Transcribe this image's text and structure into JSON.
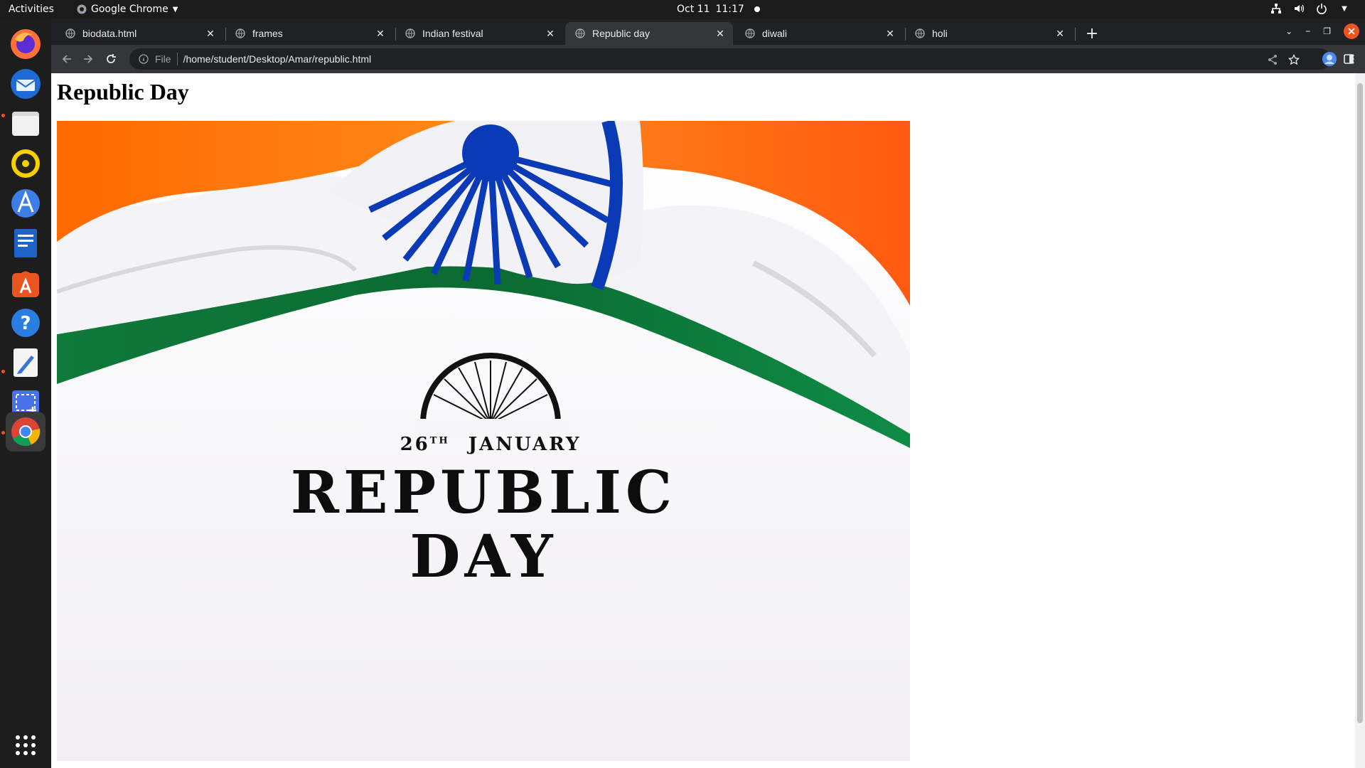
{
  "system": {
    "activities": "Activities",
    "app_name": "Google Chrome",
    "date": "Oct 11",
    "time": "11:17"
  },
  "tabs": [
    {
      "title": "biodata.html",
      "active": false
    },
    {
      "title": "frames",
      "active": false
    },
    {
      "title": "Indian festival",
      "active": false
    },
    {
      "title": "Republic day",
      "active": true
    },
    {
      "title": "diwali",
      "active": false
    },
    {
      "title": "holi",
      "active": false
    }
  ],
  "address_bar": {
    "scheme_label": "File",
    "url": "/home/student/Desktop/Amar/republic.html"
  },
  "page": {
    "heading": "Republic Day",
    "banner": {
      "date_number": "26",
      "date_suffix": "TH",
      "date_month": "JANUARY",
      "line1": "REPUBLIC",
      "line2": "DAY"
    }
  },
  "dock": [
    {
      "name": "firefox-icon"
    },
    {
      "name": "thunderbird-icon"
    },
    {
      "name": "files-icon"
    },
    {
      "name": "rhythmbox-icon"
    },
    {
      "name": "android-studio-icon"
    },
    {
      "name": "writer-icon"
    },
    {
      "name": "app-store-icon"
    },
    {
      "name": "help-icon"
    },
    {
      "name": "text-editor-icon"
    },
    {
      "name": "screenshot-icon"
    },
    {
      "name": "chrome-icon"
    }
  ],
  "colors": {
    "saffron": "#ff7722",
    "green": "#138808",
    "navy": "#0a3ab5",
    "ubuntu_orange": "#e95420"
  }
}
